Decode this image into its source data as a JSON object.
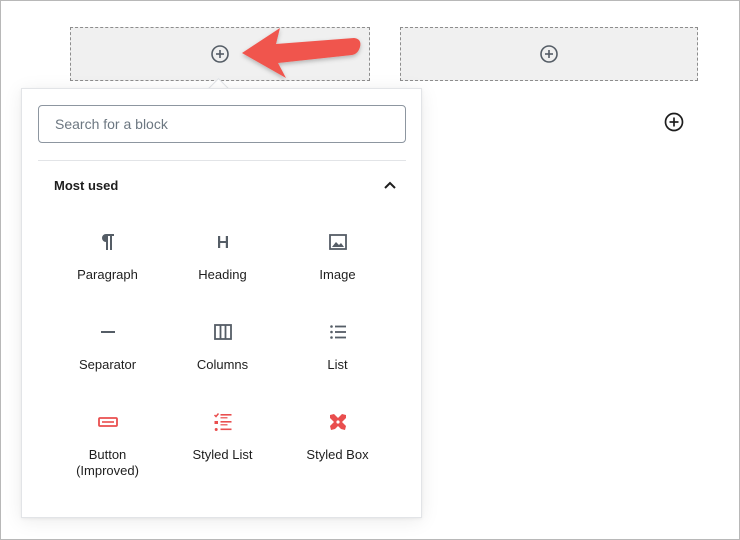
{
  "inserter": {
    "search_placeholder": "Search for a block",
    "panel_title": "Most used",
    "blocks": [
      {
        "label": "Paragraph",
        "icon": "paragraph-icon"
      },
      {
        "label": "Heading",
        "icon": "heading-icon"
      },
      {
        "label": "Image",
        "icon": "image-icon"
      },
      {
        "label": "Separator",
        "icon": "separator-icon"
      },
      {
        "label": "Columns",
        "icon": "columns-icon"
      },
      {
        "label": "List",
        "icon": "list-icon"
      },
      {
        "label": "Button (Improved)",
        "icon": "button-icon"
      },
      {
        "label": "Styled List",
        "icon": "styled-list-icon"
      },
      {
        "label": "Styled Box",
        "icon": "styled-box-icon"
      }
    ]
  },
  "colors": {
    "arrow": "#f0554d",
    "icon_default": "#555d66",
    "icon_plugin": "#e94e4e",
    "placeholder_bg": "#f0f0f0"
  }
}
